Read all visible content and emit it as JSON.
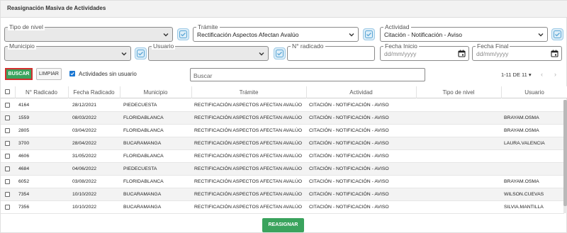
{
  "title": "Reasignación Masiva de Actividades",
  "filters": {
    "tipo_nivel": {
      "label": "Tipo de nivel",
      "value": ""
    },
    "tramite": {
      "label": "Trámite",
      "value": "Rectificación Aspectos Afectan Avalúo"
    },
    "actividad": {
      "label": "Actividad",
      "value": "Citación - Notificación - Aviso"
    },
    "municipio": {
      "label": "Municipio",
      "value": ""
    },
    "usuario": {
      "label": "Usuario",
      "value": ""
    },
    "radicado": {
      "label": "N° radicado",
      "value": ""
    },
    "fecha_inicio": {
      "label": "Fecha Inicio",
      "placeholder": "dd/mm/yyyy"
    },
    "fecha_final": {
      "label": "Fecha Final",
      "placeholder": "dd/mm/yyyy"
    }
  },
  "actions": {
    "buscar": "BUSCAR",
    "limpiar": "LIMPIAR",
    "sin_usuario": "Actividades sin usuario",
    "search_placeholder": "Buscar",
    "pager": "1-11 DE 11",
    "reasignar": "REASIGNAR"
  },
  "colors": {
    "accent_green": "#3aa35d",
    "highlight_red": "#d32f2f",
    "check_blue": "#1976d2"
  },
  "table": {
    "columns": [
      "N° Radicado",
      "Fecha Radicado",
      "Municipio",
      "Trámite",
      "Actividad",
      "Tipo de nivel",
      "Usuario"
    ],
    "rows": [
      {
        "radicado": "4164",
        "fecha": "28/12/2021",
        "municipio": "PIEDECUESTA",
        "tramite": "RECTIFICACIÓN ASPECTOS AFECTAN AVALÚO",
        "actividad": "CITACIÓN - NOTIFICACIÓN - AVISO",
        "nivel": "",
        "usuario": ""
      },
      {
        "radicado": "1559",
        "fecha": "08/03/2022",
        "municipio": "FLORIDABLANCA",
        "tramite": "RECTIFICACIÓN ASPECTOS AFECTAN AVALÚO",
        "actividad": "CITACIÓN - NOTIFICACIÓN - AVISO",
        "nivel": "",
        "usuario": "BRAYAM.OSMA"
      },
      {
        "radicado": "2805",
        "fecha": "03/04/2022",
        "municipio": "FLORIDABLANCA",
        "tramite": "RECTIFICACIÓN ASPECTOS AFECTAN AVALÚO",
        "actividad": "CITACIÓN - NOTIFICACIÓN - AVISO",
        "nivel": "",
        "usuario": "BRAYAM.OSMA"
      },
      {
        "radicado": "3700",
        "fecha": "28/04/2022",
        "municipio": "BUCARAMANGA",
        "tramite": "RECTIFICACIÓN ASPECTOS AFECTAN AVALÚO",
        "actividad": "CITACIÓN - NOTIFICACIÓN - AVISO",
        "nivel": "",
        "usuario": "LAURA.VALENCIA"
      },
      {
        "radicado": "4606",
        "fecha": "31/05/2022",
        "municipio": "FLORIDABLANCA",
        "tramite": "RECTIFICACIÓN ASPECTOS AFECTAN AVALÚO",
        "actividad": "CITACIÓN - NOTIFICACIÓN - AVISO",
        "nivel": "",
        "usuario": ""
      },
      {
        "radicado": "4684",
        "fecha": "04/06/2022",
        "municipio": "PIEDECUESTA",
        "tramite": "RECTIFICACIÓN ASPECTOS AFECTAN AVALÚO",
        "actividad": "CITACIÓN - NOTIFICACIÓN - AVISO",
        "nivel": "",
        "usuario": ""
      },
      {
        "radicado": "6052",
        "fecha": "03/08/2022",
        "municipio": "FLORIDABLANCA",
        "tramite": "RECTIFICACIÓN ASPECTOS AFECTAN AVALÚO",
        "actividad": "CITACIÓN - NOTIFICACIÓN - AVISO",
        "nivel": "",
        "usuario": "BRAYAM.OSMA"
      },
      {
        "radicado": "7354",
        "fecha": "10/10/2022",
        "municipio": "BUCARAMANGA",
        "tramite": "RECTIFICACIÓN ASPECTOS AFECTAN AVALÚO",
        "actividad": "CITACIÓN - NOTIFICACIÓN - AVISO",
        "nivel": "",
        "usuario": "WILSON.CUEVAS"
      },
      {
        "radicado": "7356",
        "fecha": "10/10/2022",
        "municipio": "BUCARAMANGA",
        "tramite": "RECTIFICACIÓN ASPECTOS AFECTAN AVALÚO",
        "actividad": "CITACIÓN - NOTIFICACIÓN - AVISO",
        "nivel": "",
        "usuario": "SILVIA.MANTILLA"
      }
    ]
  }
}
